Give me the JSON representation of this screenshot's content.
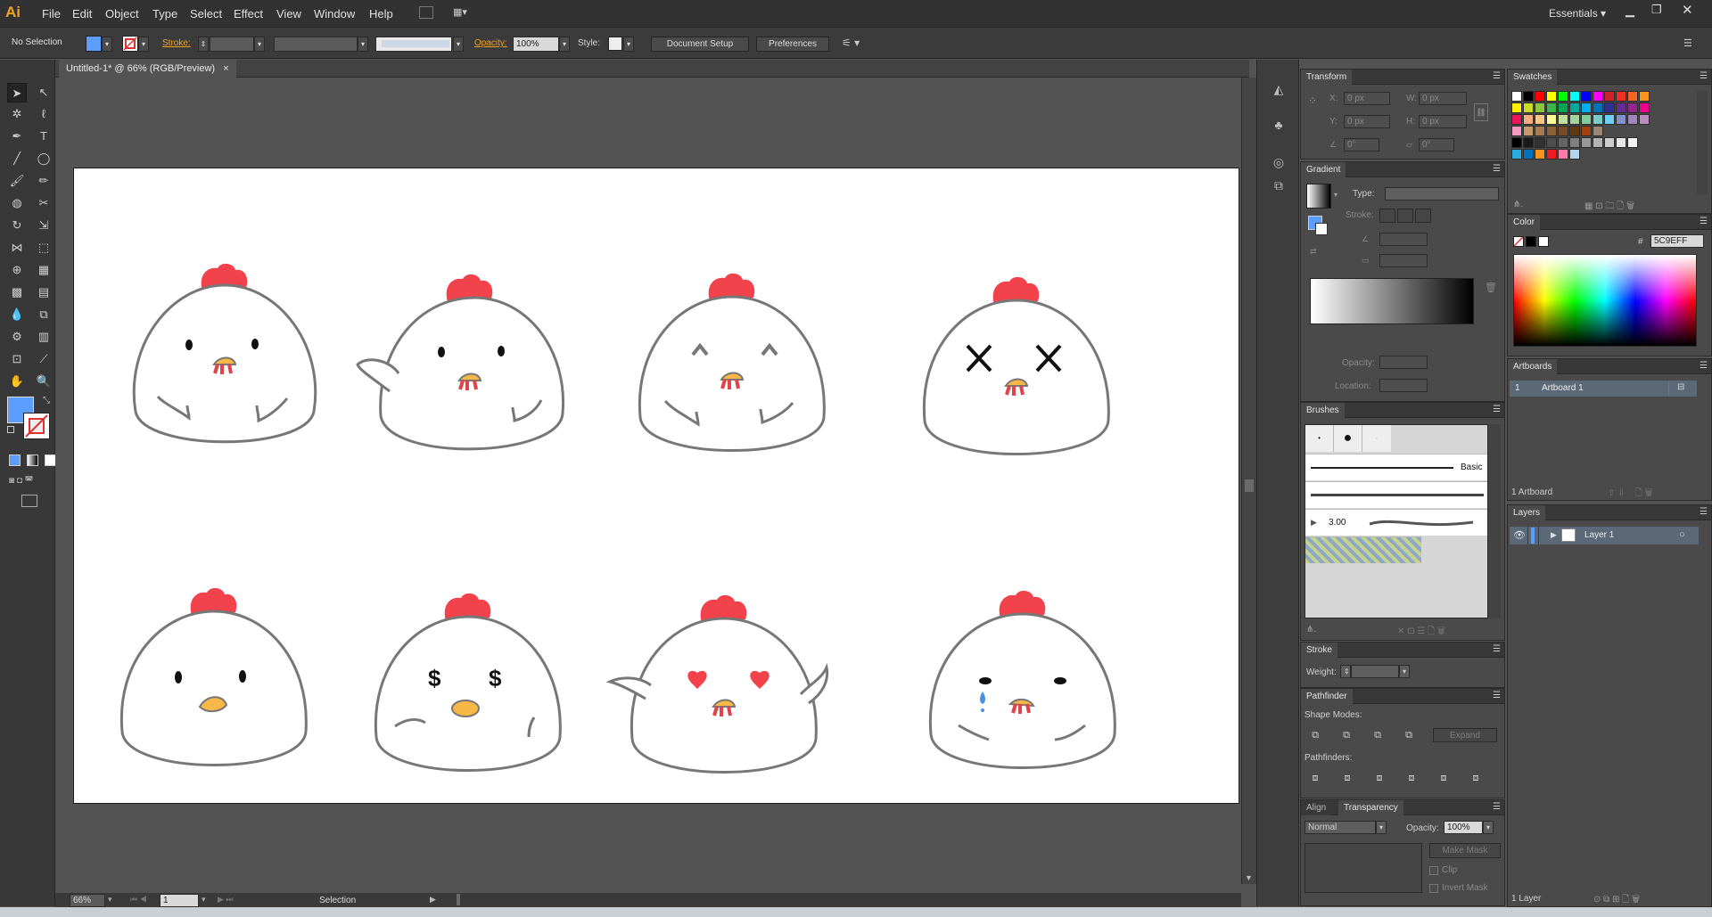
{
  "app": {
    "logo": "Ai",
    "workspace": "Essentials"
  },
  "menu": [
    "File",
    "Edit",
    "Object",
    "Type",
    "Select",
    "Effect",
    "View",
    "Window",
    "Help"
  ],
  "control_bar": {
    "selection_status": "No Selection",
    "fill_color": "#5C9EFF",
    "stroke_label": "Stroke:",
    "opacity_label": "Opacity:",
    "opacity_value": "100%",
    "style_label": "Style:",
    "document_setup": "Document Setup",
    "preferences": "Preferences"
  },
  "document": {
    "tab_title": "Untitled-1* @ 66% (RGB/Preview)"
  },
  "status": {
    "zoom": "66%",
    "artboard_number": "1",
    "tool": "Selection"
  },
  "panels": {
    "transform": {
      "title": "Transform",
      "x_label": "X:",
      "x_value": "0 px",
      "y_label": "Y:",
      "y_value": "0 px",
      "w_label": "W:",
      "w_value": "0 px",
      "h_label": "H:",
      "h_value": "0 px",
      "rotate_value": "0°",
      "shear_value": "0°"
    },
    "gradient": {
      "title": "Gradient",
      "type_label": "Type:",
      "stroke_label": "Stroke:",
      "opacity_label": "Opacity:",
      "location_label": "Location:"
    },
    "brushes": {
      "title": "Brushes",
      "basic_label": "Basic",
      "size_label": "3.00"
    },
    "stroke": {
      "title": "Stroke",
      "weight_label": "Weight:"
    },
    "pathfinder": {
      "title": "Pathfinder",
      "shape_modes_label": "Shape Modes:",
      "pathfinders_label": "Pathfinders:",
      "expand_label": "Expand"
    },
    "transparency": {
      "tab_align": "Align",
      "tab_transparency": "Transparency",
      "blend_mode": "Normal",
      "opacity_label": "Opacity:",
      "opacity_value": "100%",
      "make_mask": "Make Mask",
      "clip_label": "Clip",
      "invert_mask_label": "Invert Mask"
    },
    "swatches": {
      "title": "Swatches",
      "rows": [
        [
          "#ffffff",
          "#000000",
          "#ff0000",
          "#ffff00",
          "#00ff00",
          "#00ffff",
          "#0000ff",
          "#ff00ff",
          "#cc2229",
          "#ee3124",
          "#f26522",
          "#f7941d"
        ],
        [
          "#fff200",
          "#cbdb2a",
          "#8dc63f",
          "#39b54a",
          "#00a651",
          "#00a99d",
          "#00aeef",
          "#0072bc",
          "#2e3192",
          "#662d91",
          "#92278f",
          "#ec008c"
        ],
        [
          "#ed145b",
          "#f9ad81",
          "#fdc689",
          "#fff799",
          "#c4df9b",
          "#a3d39c",
          "#82ca9c",
          "#7accc8",
          "#6dcff6",
          "#8393ca",
          "#a186be",
          "#bd8cbf"
        ],
        [
          "#f49ac1",
          "#c69c6d",
          "#a67c52",
          "#8c6239",
          "#754c24",
          "#603913",
          "#a0410d",
          "#998675"
        ],
        [
          "#000000",
          "#1a1a1a",
          "#333333",
          "#4d4d4d",
          "#666666",
          "#808080",
          "#999999",
          "#b3b3b3",
          "#cccccc",
          "#e6e6e6",
          "#f2f2f2"
        ],
        [
          "#29abe2",
          "#0071bc",
          "#f7931e",
          "#ed1c24",
          "#ff7bac",
          "#b3d6ed"
        ]
      ]
    },
    "color": {
      "title": "Color",
      "hex_label": "#",
      "hex_value": "5C9EFF"
    },
    "artboards": {
      "title": "Artboards",
      "row_number": "1",
      "row_name": "Artboard 1",
      "footer": "1 Artboard"
    },
    "layers": {
      "title": "Layers",
      "layer_name": "Layer 1",
      "footer": "1 Layer"
    }
  },
  "colors": {
    "accent": "#5C9EFF",
    "comb": "#f2434d",
    "beak": "#f7b847",
    "outline": "#777777"
  }
}
